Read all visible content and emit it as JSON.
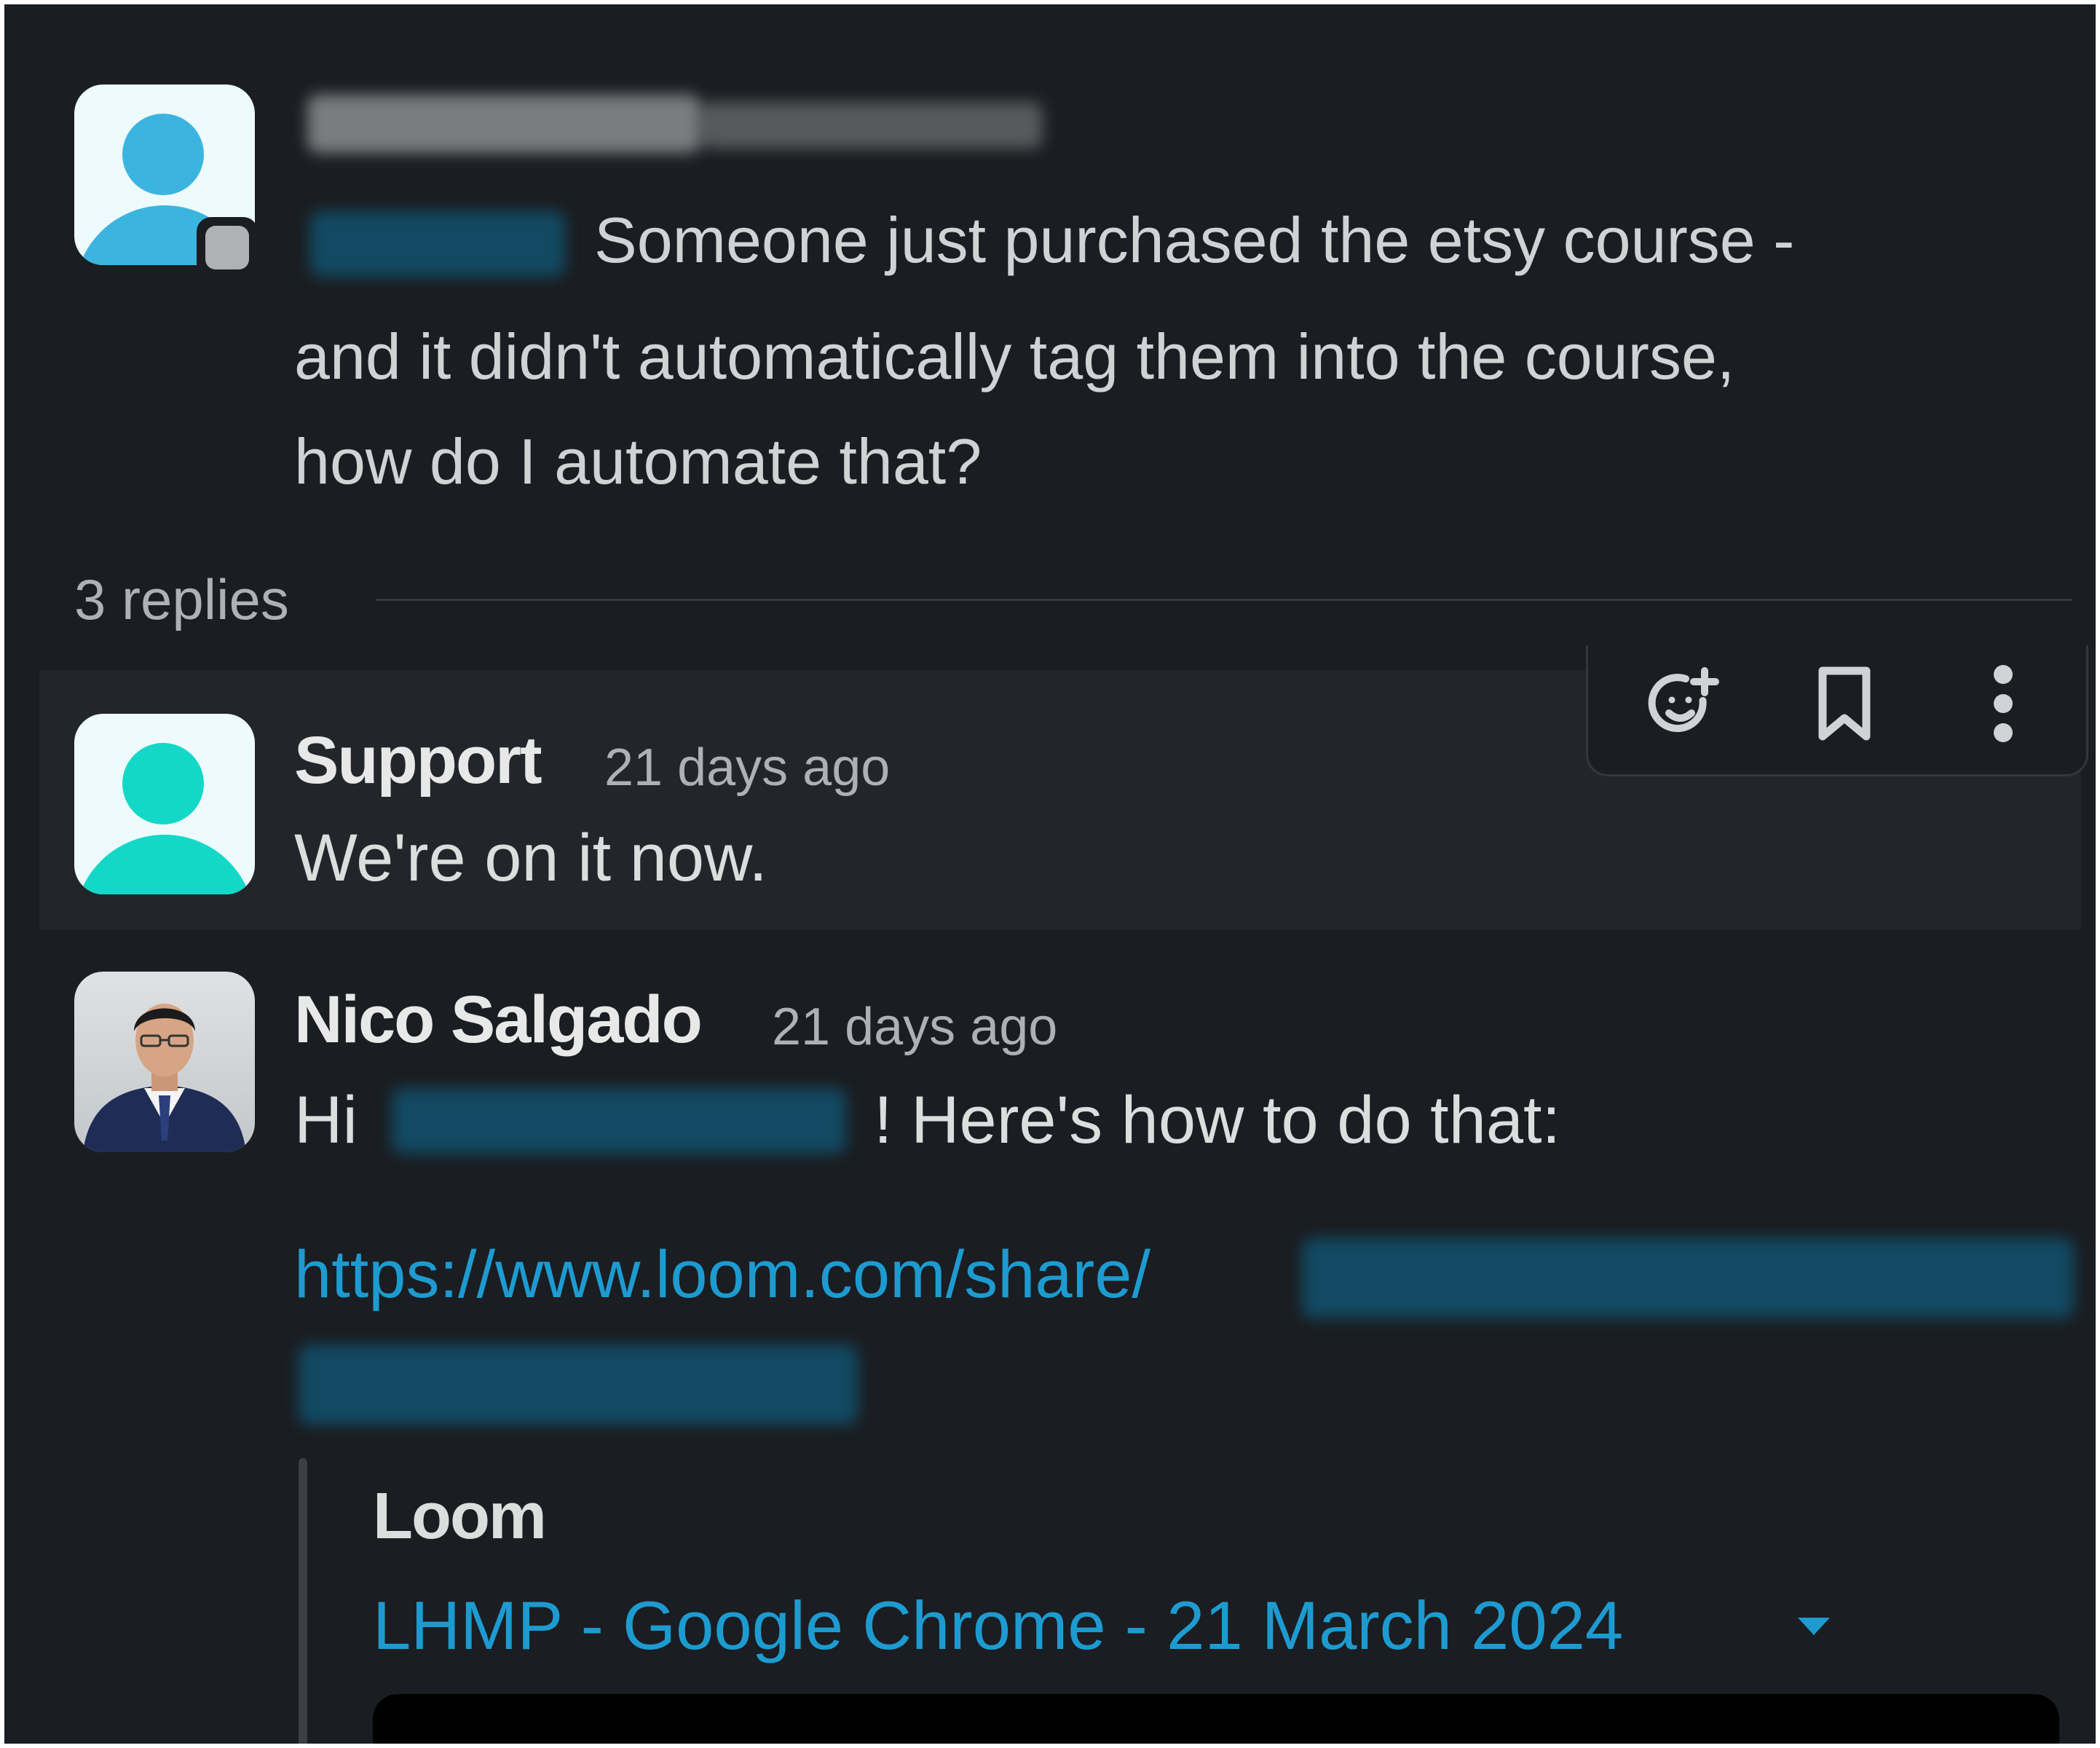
{
  "parent_message": {
    "text_line1": "Someone just purchased the etsy course -",
    "text_line2": "and it didn't automatically tag them into the course,",
    "text_line3": "how do I automate that?"
  },
  "thread": {
    "replies_label": "3 replies"
  },
  "toolbar": {
    "icons": [
      "add-reaction-icon",
      "bookmark-icon",
      "more-actions-icon"
    ]
  },
  "replies": [
    {
      "author": "Support",
      "time": "21 days ago",
      "text": "We're on it now."
    },
    {
      "author": "Nico Salgado",
      "time": "21 days ago",
      "greeting": "Hi",
      "greeting_tail": "! Here's how to do that:",
      "link_text": "https://www.loom.com/share/"
    }
  ],
  "unfurl": {
    "source": "Loom",
    "title": "LHMP - Google Chrome - 21 March 2024"
  },
  "colors": {
    "background": "#1a1d21",
    "hover_row": "#222529",
    "link": "#1d9bd1",
    "support_avatar": "#13d8c7",
    "user_avatar": "#3bb5e0",
    "redaction": "#124a63"
  }
}
